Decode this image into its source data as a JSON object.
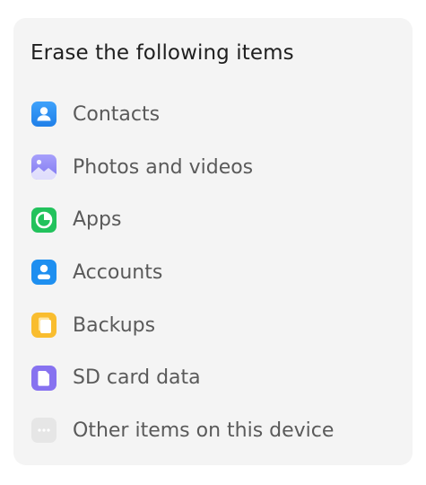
{
  "dialog": {
    "title": "Erase the following items",
    "items": [
      {
        "label": "Contacts",
        "icon": "contacts-icon",
        "color": "#2f8cf2"
      },
      {
        "label": "Photos and videos",
        "icon": "photos-icon",
        "color": "#8e86f5"
      },
      {
        "label": "Apps",
        "icon": "apps-icon",
        "color": "#22c25c"
      },
      {
        "label": "Accounts",
        "icon": "accounts-icon",
        "color": "#1e8ff0"
      },
      {
        "label": "Backups",
        "icon": "backups-icon",
        "color": "#f9bd2f"
      },
      {
        "label": "SD card data",
        "icon": "sd-card-icon",
        "color": "#8772f0"
      },
      {
        "label": "Other items on this device",
        "icon": "more-icon",
        "color": "#e6e6e6"
      }
    ]
  }
}
